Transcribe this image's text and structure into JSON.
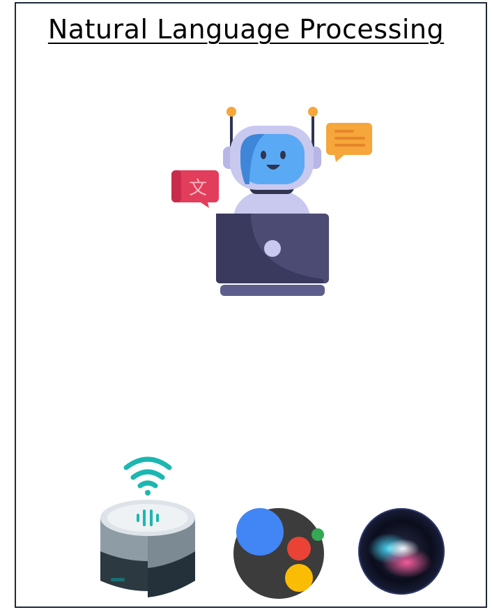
{
  "diagram": {
    "title": "Natural Language Processing",
    "translation_glyph": "文"
  },
  "icons": {
    "robot": "robot-laptop-icon",
    "translate": "translate-bubble-icon",
    "chat": "chat-bubble-icon",
    "speaker": "smart-speaker-icon",
    "assistant": "google-assistant-icon",
    "siri": "siri-icon"
  },
  "colors": {
    "border": "#1f2a3a",
    "robot_face": "#5aa9f5",
    "robot_head": "#c9c8ef",
    "laptop": "#4b4b74",
    "translate_bubble": "#e23d5b",
    "chat_bubble": "#f6a63a",
    "antenna_tip": "#f6a63a",
    "wifi": "#1bb7b0",
    "assistant_blue": "#4285f4",
    "assistant_red": "#ea4335",
    "assistant_yellow": "#fbbc05",
    "assistant_green": "#34a853"
  }
}
